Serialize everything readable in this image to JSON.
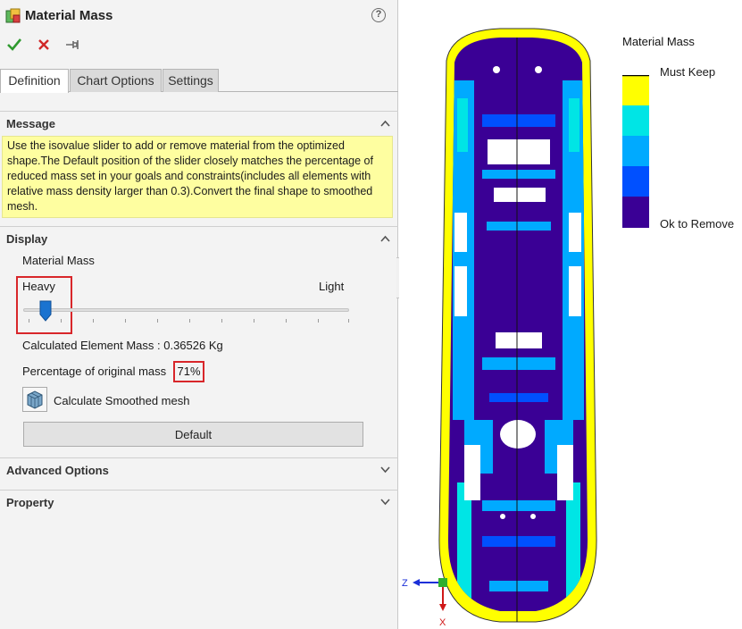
{
  "panel": {
    "title": "Material Mass",
    "help": "?",
    "tabs": [
      {
        "label": "Definition",
        "active": true
      },
      {
        "label": "Chart Options",
        "active": false
      },
      {
        "label": "Settings",
        "active": false
      }
    ],
    "sections": {
      "message": "Message",
      "display": "Display",
      "advanced": "Advanced Options",
      "property": "Property"
    },
    "message_text": "Use the isovalue slider to add or remove material from the optimized shape.The Default  position of the slider closely matches the percentage of reduced mass set in your goals and constraints(includes all elements with relative mass density larger than 0.3).Convert the final shape to smoothed mesh.",
    "display": {
      "label": "Material Mass",
      "slider_left": "Heavy",
      "slider_right": "Light",
      "slider_position": 0.06,
      "calculated_mass": "Calculated Element Mass : 0.36526 Kg",
      "pct_label": "Percentage of original mass",
      "pct_value": "71%",
      "smooth_mesh_label": "Calculate Smoothed mesh",
      "default_button": "Default"
    }
  },
  "legend": {
    "title": "Material Mass",
    "top_label": "Must Keep",
    "bottom_label": "Ok to Remove",
    "colors": [
      "#ffff00",
      "#00e5e5",
      "#00aaff",
      "#0050ff",
      "#3a0095"
    ]
  },
  "triad": {
    "z": "Z",
    "x": "X"
  },
  "icons": {
    "title": "material-mass-icon",
    "ok": "check-icon",
    "cancel": "x-icon",
    "pin": "pushpin-icon",
    "mesh": "smoothed-mesh-icon"
  }
}
